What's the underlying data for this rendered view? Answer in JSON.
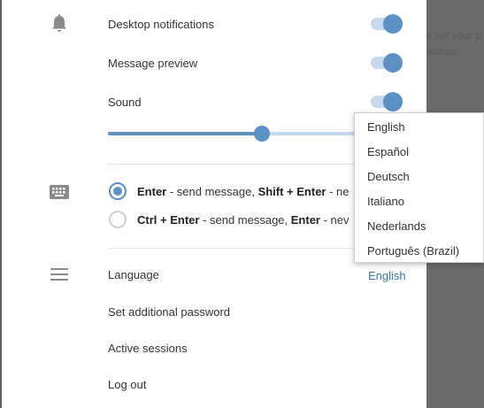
{
  "background_text": [
    "s set your p",
    "ettings."
  ],
  "notifications": {
    "desktop_label": "Desktop notifications",
    "desktop_enabled": true,
    "preview_label": "Message preview",
    "preview_enabled": true,
    "sound_label": "Sound",
    "sound_enabled": true,
    "volume_fraction": 0.58
  },
  "send_mode": {
    "options": [
      {
        "key1": "Enter",
        "text1": " - send message, ",
        "key2": "Shift + Enter",
        "text2": " - ne",
        "selected": true
      },
      {
        "key1": "Ctrl + Enter",
        "text1": " - send message, ",
        "key2": "Enter",
        "text2": " - nev",
        "selected": false
      }
    ]
  },
  "settings": {
    "language_label": "Language",
    "language_value": "English",
    "password_label": "Set additional password",
    "sessions_label": "Active sessions",
    "logout_label": "Log out"
  },
  "language_menu": [
    "English",
    "Español",
    "Deutsch",
    "Italiano",
    "Nederlands",
    "Português (Brazil)"
  ],
  "icons": {
    "notifications": "bell-icon",
    "keyboard": "keyboard-icon",
    "menu": "hamburger-menu-icon"
  },
  "colors": {
    "accent": "#5b91c4",
    "accent_light": "#c5d9ec",
    "link": "#3b77b5",
    "overlay": "#6b6b6b"
  }
}
